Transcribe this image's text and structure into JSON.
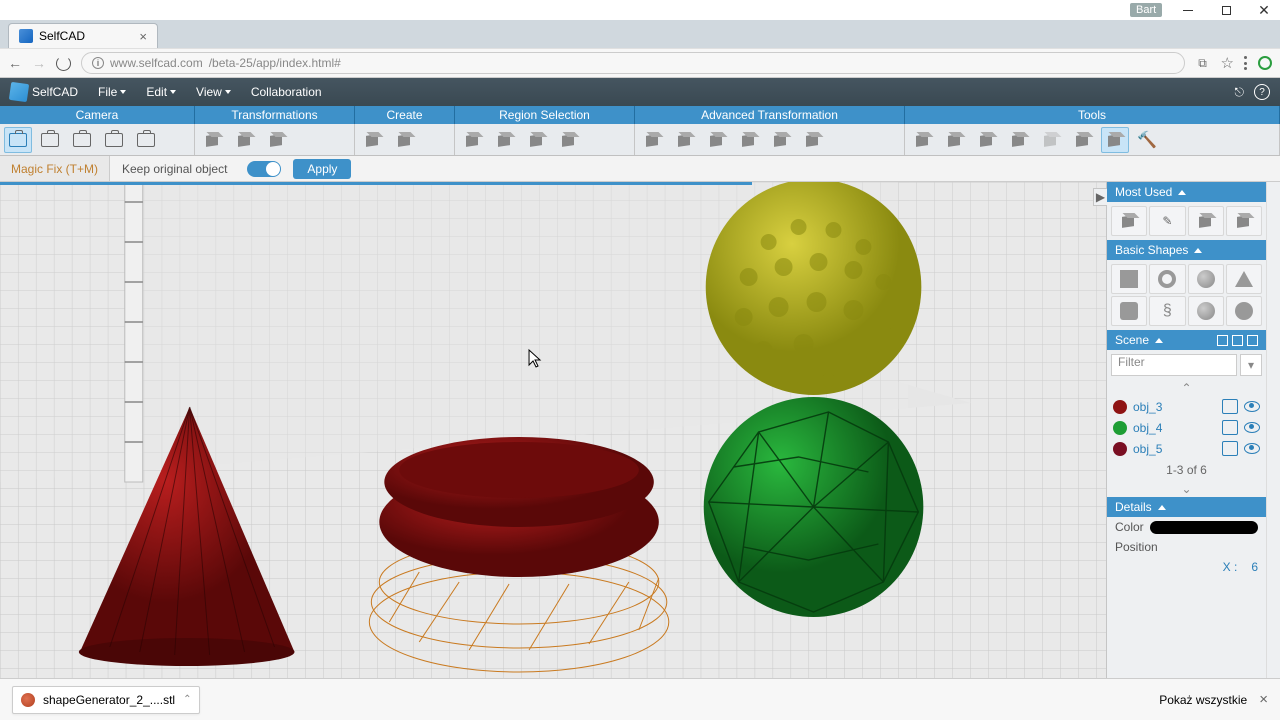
{
  "window": {
    "user": "Bart"
  },
  "tab": {
    "title": "SelfCAD"
  },
  "url": {
    "host": "www.selfcad.com",
    "path": "/beta-25/app/index.html#"
  },
  "app": {
    "name": "SelfCAD"
  },
  "menu": {
    "file": "File",
    "edit": "Edit",
    "view": "View",
    "collab": "Collaboration"
  },
  "ribbon": {
    "camera": "Camera",
    "transform": "Transformations",
    "create": "Create",
    "region": "Region Selection",
    "advtrans": "Advanced Transformation",
    "tools": "Tools"
  },
  "optbar": {
    "name": "Magic Fix (T+M)",
    "keep": "Keep original object",
    "apply": "Apply"
  },
  "side": {
    "mostused": "Most Used",
    "basic": "Basic Shapes",
    "scene": "Scene",
    "filter_ph": "Filter",
    "objs": [
      {
        "label": "obj_3",
        "color": "#8f1414"
      },
      {
        "label": "obj_4",
        "color": "#1e9e35"
      },
      {
        "label": "obj_5",
        "color": "#7a0f23"
      }
    ],
    "pager": "1-3 of 6",
    "details": "Details",
    "color": "Color",
    "position": "Position",
    "xy_x": "X :",
    "xy_v": "6"
  },
  "download": {
    "file": "shapeGenerator_2_....stl",
    "showall": "Pokaż wszystkie"
  },
  "progress_pct": 68
}
